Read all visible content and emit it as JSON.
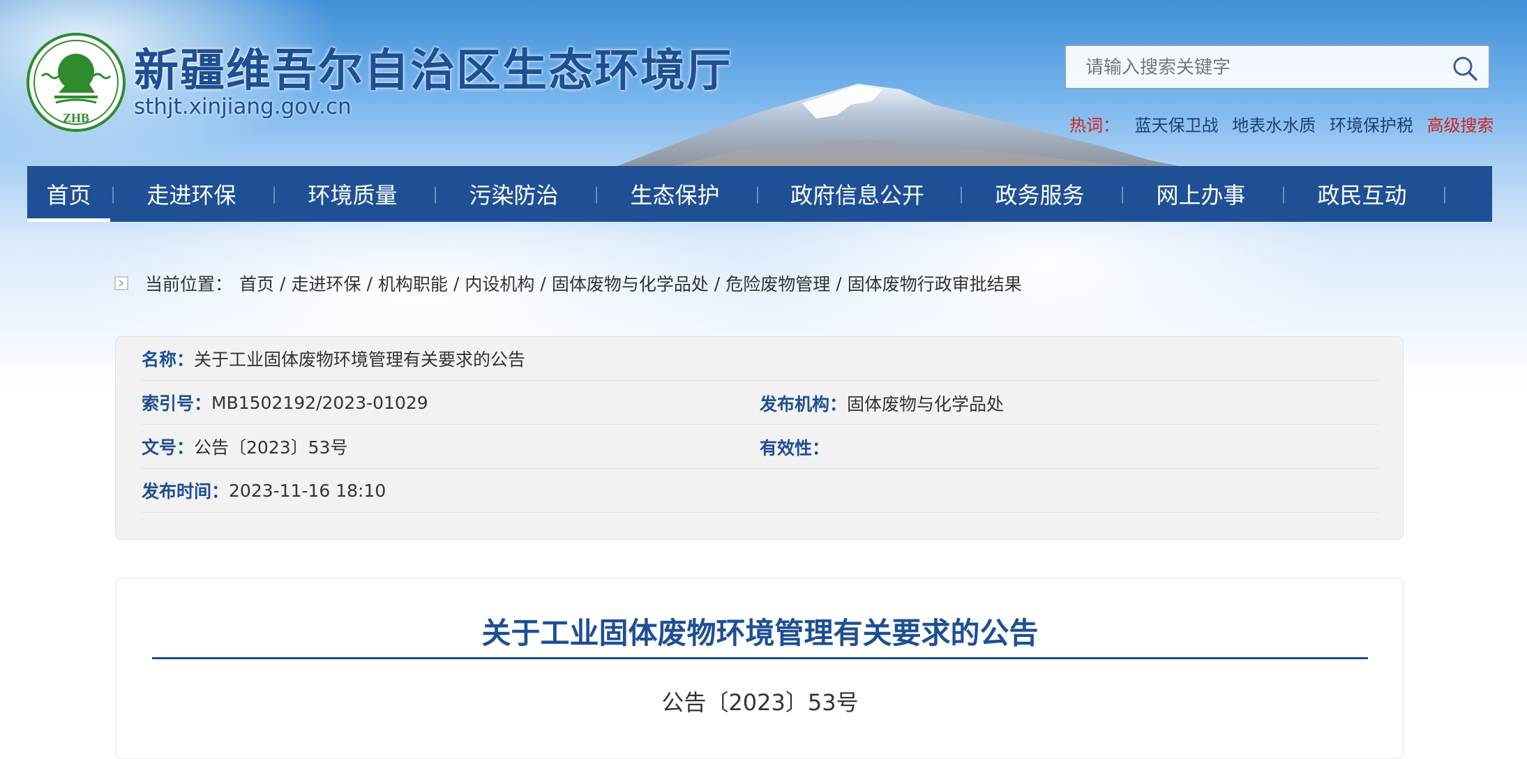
{
  "header": {
    "site_title": "新疆维吾尔自治区生态环境厅",
    "site_url": "sthjt.xinjiang.gov.cn",
    "logo_text": "ZHB",
    "search_placeholder": "请输入搜索关键字",
    "hotwords_label": "热词：",
    "hotwords": [
      "蓝天保卫战",
      "地表水水质",
      "环境保护税"
    ],
    "advanced_search": "高级搜索"
  },
  "nav": {
    "items": [
      "首页",
      "走进环保",
      "环境质量",
      "污染防治",
      "生态保护",
      "政府信息公开",
      "政务服务",
      "网上办事",
      "政民互动"
    ],
    "active_index": 0,
    "separator": "|"
  },
  "breadcrumb": {
    "label": "当前位置：",
    "items": [
      "首页",
      "走进环保",
      "机构职能",
      "内设机构",
      "固体废物与化学品处",
      "危险废物管理",
      "固体废物行政审批结果"
    ],
    "separator": "/"
  },
  "meta": {
    "name_key": "名称：",
    "name_val": "关于工业固体废物环境管理有关要求的公告",
    "index_key": "索引号：",
    "index_val": "MB1502192/2023-01029",
    "org_key": "发布机构：",
    "org_val": "固体废物与化学品处",
    "docno_key": "文号：",
    "docno_val": "公告〔2023〕53号",
    "validity_key": "有效性：",
    "validity_val": "",
    "date_key": "发布时间：",
    "date_val": "2023-11-16 18:10"
  },
  "article": {
    "title": "关于工业固体废物环境管理有关要求的公告",
    "doc_number": "公告〔2023〕53号"
  },
  "colors": {
    "brand_blue": "#1f5096",
    "title_blue": "#1d4f93",
    "hot_red": "#d4231c",
    "logo_green": "#2e8b2e"
  }
}
